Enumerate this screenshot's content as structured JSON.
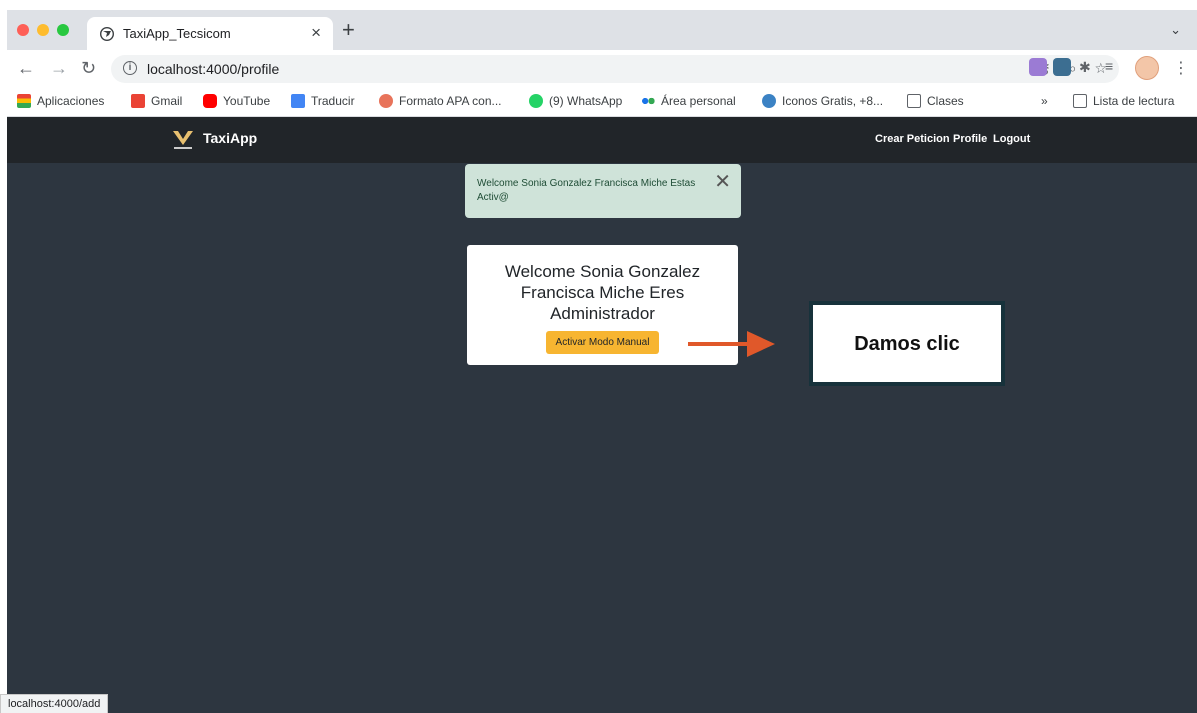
{
  "browser": {
    "tab_title": "TaxiApp_Tecsicom",
    "tab_close": "×",
    "new_tab": "+",
    "tab_menu": "⌄",
    "url": "localhost:4000/profile",
    "status_url": "localhost:4000/add"
  },
  "bookmarks": [
    {
      "label": "Aplicaciones",
      "icon": "apps-grid-icon",
      "color": "#4285f4"
    },
    {
      "label": "Gmail",
      "icon": "gmail-icon",
      "color": "#ea4335"
    },
    {
      "label": "YouTube",
      "icon": "youtube-icon",
      "color": "#ff0000"
    },
    {
      "label": "Traducir",
      "icon": "translate-icon",
      "color": "#4285f4"
    },
    {
      "label": "Formato APA con...",
      "icon": "apa-icon",
      "color": "#e8735a"
    },
    {
      "label": "(9) WhatsApp",
      "icon": "whatsapp-icon",
      "color": "#25d366"
    },
    {
      "label": "Área personal",
      "icon": "dots-icon",
      "color": "#1a73e8"
    },
    {
      "label": "Iconos Gratis, +8...",
      "icon": "flaticon-icon",
      "color": "#3b82c4"
    },
    {
      "label": "Clases",
      "icon": "folder-icon",
      "color": "#5f6368"
    }
  ],
  "bookmarks_overflow": "»",
  "reading_list": "Lista de lectura",
  "app": {
    "brand": "TaxiApp",
    "nav": [
      "Crear Peticion",
      "Profile",
      "Logout"
    ],
    "alert": "Welcome Sonia Gonzalez Francisca Miche Estas Activ@",
    "alert_close": "✕",
    "card_title": "Welcome Sonia Gonzalez Francisca Miche Eres Administrador",
    "card_button": "Activar Modo Manual"
  },
  "annotation": {
    "callout": "Damos clic",
    "arrow_color": "#e0582a"
  },
  "colors": {
    "page_bg": "#2d3640",
    "navbar_bg": "#212529",
    "alert_bg": "#cfe3d9",
    "button_bg": "#f7b531"
  }
}
